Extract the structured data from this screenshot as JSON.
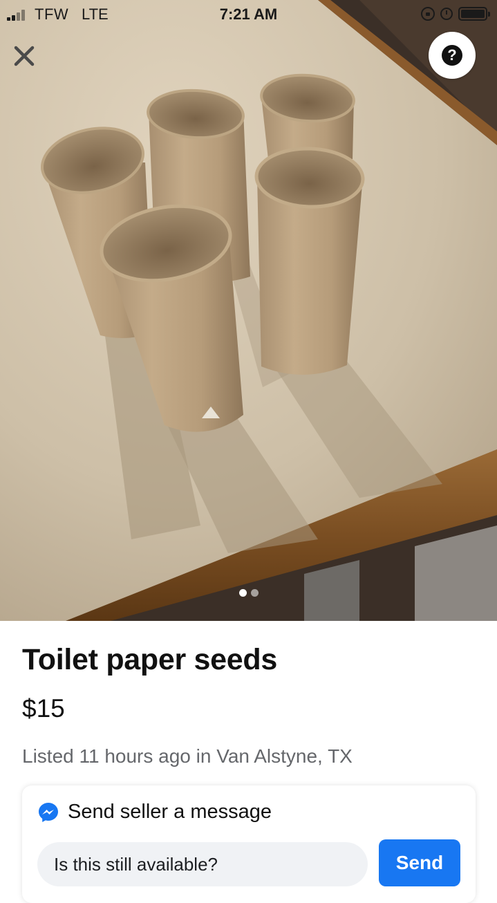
{
  "status_bar": {
    "carrier": "TFW",
    "network": "LTE",
    "time": "7:21 AM",
    "icons": [
      "signal-icon",
      "rotation-lock-icon",
      "alarm-icon",
      "battery-icon"
    ]
  },
  "photo": {
    "description_icon": "photo-of-cardboard-tubes",
    "page_index": 1,
    "page_count": 2,
    "close_icon": "close-icon",
    "help_icon": "help-icon"
  },
  "listing": {
    "title": "Toilet paper seeds",
    "price": "$15",
    "listed": "Listed 11 hours ago in Van Alstyne, TX"
  },
  "message_card": {
    "title": "Send seller a message",
    "icon": "messenger-icon",
    "input_value": "Is this still available?",
    "send_label": "Send"
  },
  "colors": {
    "accent": "#1877f2",
    "input_bg": "#f0f2f5",
    "secondary_text": "#65676b"
  }
}
